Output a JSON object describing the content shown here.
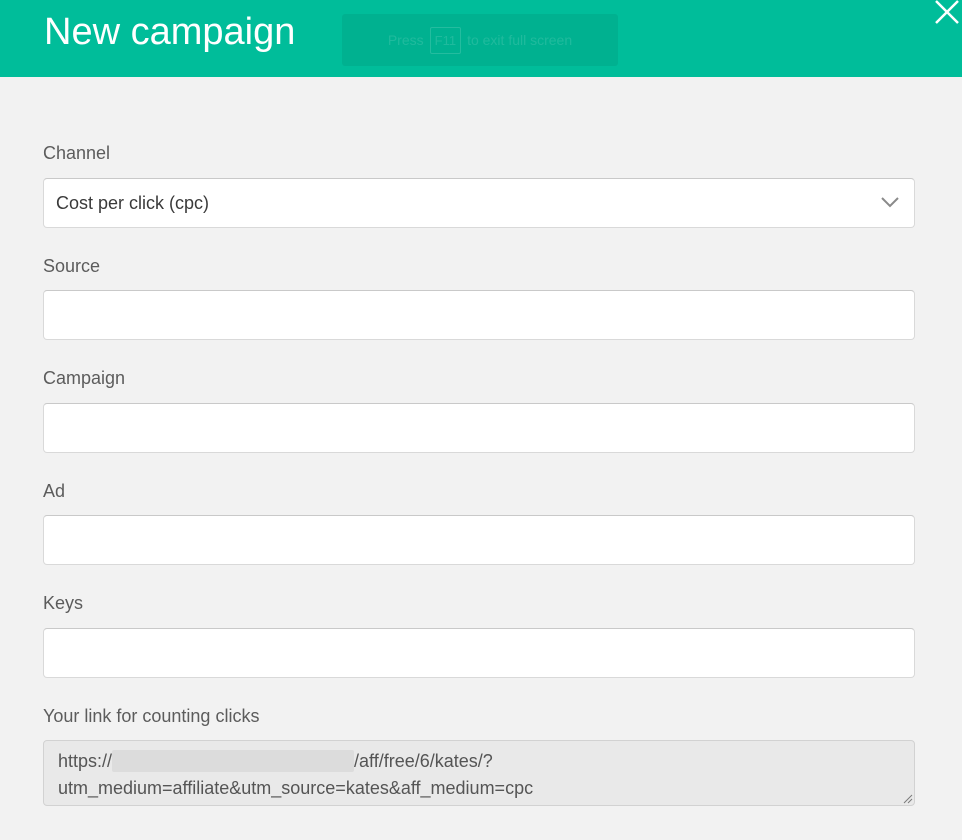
{
  "header": {
    "title": "New campaign",
    "fullscreen_hint": {
      "before": "Press",
      "key": "F11",
      "after": "to exit full screen"
    }
  },
  "colors": {
    "header_bg": "#00bd9a",
    "page_bg": "#f2f2f2"
  },
  "icons": {
    "close": "close-icon",
    "select_arrow": "chevron-down-icon"
  },
  "form": {
    "channel": {
      "label": "Channel",
      "selected": "Cost per click (cpc)"
    },
    "source": {
      "label": "Source",
      "value": ""
    },
    "campaign": {
      "label": "Campaign",
      "value": ""
    },
    "ad": {
      "label": "Ad",
      "value": ""
    },
    "keys": {
      "label": "Keys",
      "value": ""
    },
    "link": {
      "label": "Your link for counting clicks",
      "prefix": "https://",
      "path": "/aff/free/6/kates/?",
      "query": "utm_medium=affiliate&utm_source=kates&aff_medium=cpc"
    }
  }
}
